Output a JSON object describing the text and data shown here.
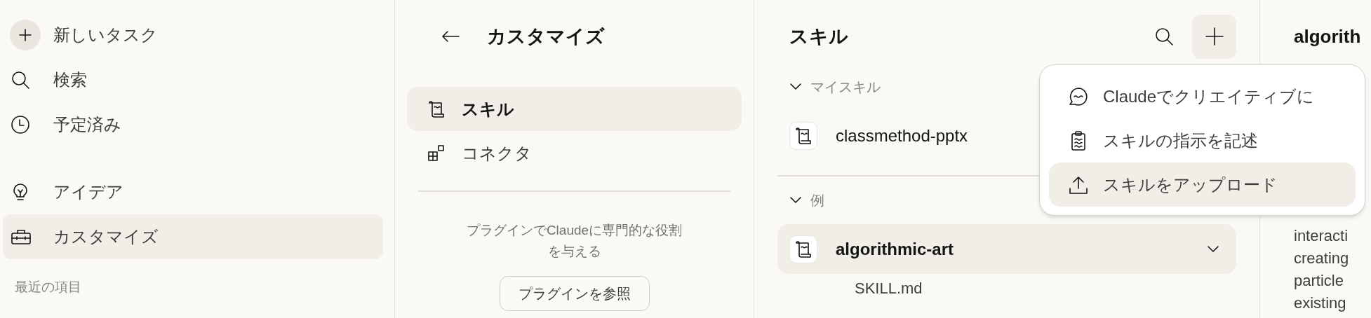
{
  "sidebar": {
    "groups": [
      [
        {
          "label": "新しいタスク",
          "selected": false
        },
        {
          "label": "検索",
          "selected": false
        },
        {
          "label": "予定済み",
          "selected": false
        }
      ],
      [
        {
          "label": "アイデア",
          "selected": false
        },
        {
          "label": "カスタマイズ",
          "selected": true
        }
      ]
    ],
    "section_label": "最近の項目"
  },
  "customize": {
    "title": "カスタマイズ",
    "items": [
      {
        "label": "スキル",
        "selected": true
      },
      {
        "label": "コネクタ",
        "selected": false
      }
    ],
    "description": "プラグインでClaudeに専門的な役割を与える",
    "browse_button": "プラグインを参照"
  },
  "skills": {
    "title": "スキル",
    "sections": [
      {
        "label": "マイスキル",
        "expanded": true,
        "skills": [
          {
            "name": "classmethod-pptx",
            "selected": false
          }
        ]
      },
      {
        "label": "例",
        "expanded": true,
        "skills": [
          {
            "name": "algorithmic-art",
            "selected": true,
            "children": [
              {
                "name": "SKILL.md"
              }
            ]
          }
        ]
      }
    ]
  },
  "add_menu": {
    "items": [
      {
        "label": "Claudeでクリエイティブに",
        "selected": false
      },
      {
        "label": "スキルの指示を記述",
        "selected": false
      },
      {
        "label": "スキルをアップロード",
        "selected": true
      }
    ]
  },
  "detail": {
    "title": "algorith",
    "lines": [
      "interacti",
      "creating",
      "particle",
      "existing"
    ]
  }
}
